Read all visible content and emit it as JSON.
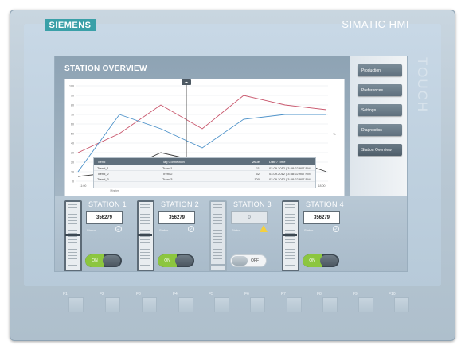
{
  "device": {
    "brand": "SIEMENS",
    "model": "SIMATIC HMI",
    "side_label": "TOUCH"
  },
  "screen": {
    "title": "STATION OVERVIEW",
    "nav": [
      {
        "label": "Production"
      },
      {
        "label": "Preferences"
      },
      {
        "label": "Settings"
      },
      {
        "label": "Diagnostics"
      },
      {
        "label": "Station Overview",
        "active": true
      }
    ],
    "trend_table": {
      "headers": [
        "Trend",
        "Tag Connection",
        "Value",
        "Date / Time"
      ],
      "rows": [
        [
          "Trend_1",
          "Trend1",
          "11",
          "03.09.2012 | 3:38:02:907 PM"
        ],
        [
          "Trend_2",
          "Trend2",
          "52",
          "03.09.2012 | 3:38:02:907 PM"
        ],
        [
          "Trend_3",
          "Trend3",
          "100",
          "03.09.2012 | 3:38:02:907 PM"
        ]
      ]
    },
    "stations": [
      {
        "title": "STATION 1",
        "value": "356279",
        "status_label": "Status",
        "status": "ok",
        "switch": "ON",
        "level": 0.48
      },
      {
        "title": "STATION 2",
        "value": "356279",
        "status_label": "Status",
        "status": "ok",
        "switch": "ON",
        "level": 0.48
      },
      {
        "title": "STATION 3",
        "value": "0",
        "status_label": "Status",
        "status": "warning",
        "switch": "OFF",
        "level": 0.0
      },
      {
        "title": "STATION 4",
        "value": "356279",
        "status_label": "Status",
        "status": "ok",
        "switch": "ON",
        "level": 0.48
      }
    ]
  },
  "function_keys": [
    "F1",
    "F2",
    "F3",
    "F4",
    "F5",
    "F6",
    "F7",
    "F8",
    "F9",
    "F10"
  ],
  "chart_data": {
    "type": "line",
    "title": "",
    "xlabel": "Minutes",
    "ylabel": "",
    "right_axis_label": "%",
    "x": [
      "11:00",
      "12:00",
      "13:00",
      "14:00",
      "14:00",
      "15:00",
      "16:00",
      "17:00",
      "16:00",
      "17:00",
      "17:00",
      "18:00"
    ],
    "ylim": [
      0,
      100
    ],
    "y_ticks": [
      0,
      10,
      20,
      30,
      40,
      50,
      60,
      70,
      80,
      90,
      100
    ],
    "series": [
      {
        "color": "#c8556b",
        "values": [
          30,
          50,
          80,
          55,
          90,
          80,
          75
        ]
      },
      {
        "color": "#4a90c8",
        "values": [
          10,
          70,
          55,
          35,
          65,
          70,
          70
        ]
      },
      {
        "color": "#3c3c3c",
        "values": [
          5,
          10,
          30,
          20,
          10,
          25,
          10
        ]
      }
    ],
    "cursor_x_index": 3,
    "colors": {
      "cursor": "#333333"
    }
  }
}
